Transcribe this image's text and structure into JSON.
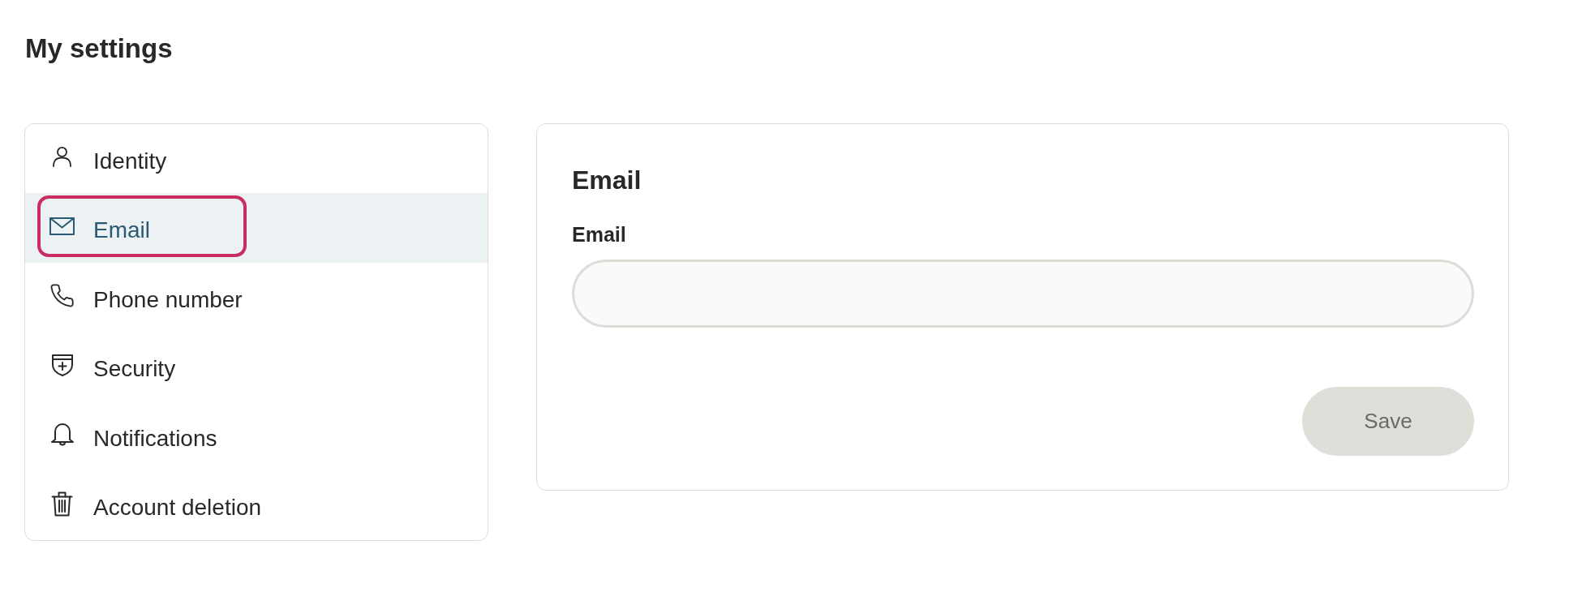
{
  "page_title": "My settings",
  "sidebar": {
    "items": [
      {
        "label": "Identity",
        "selected": false,
        "focused": false
      },
      {
        "label": "Email",
        "selected": true,
        "focused": true
      },
      {
        "label": "Phone number",
        "selected": false,
        "focused": false
      },
      {
        "label": "Security",
        "selected": false,
        "focused": false
      },
      {
        "label": "Notifications",
        "selected": false,
        "focused": false
      },
      {
        "label": "Account deletion",
        "selected": false,
        "focused": false
      }
    ]
  },
  "panel": {
    "title": "Email",
    "field": {
      "label": "Email"
    },
    "save_button": {
      "label": "Save",
      "disabled": true
    }
  }
}
